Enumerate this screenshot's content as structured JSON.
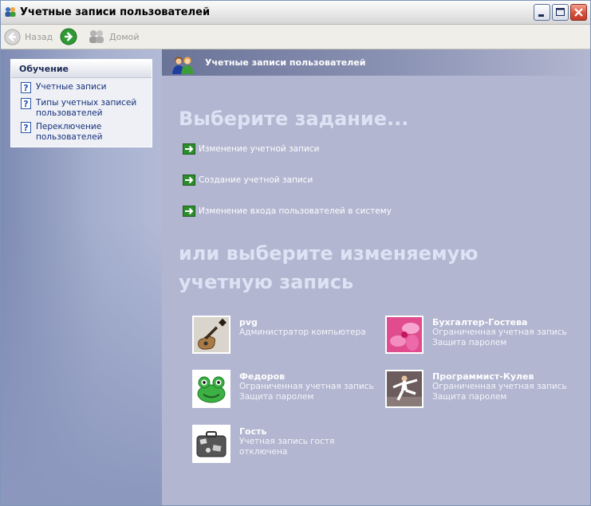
{
  "window": {
    "title": "Учетные записи пользователей"
  },
  "toolbar": {
    "back_label": "Назад",
    "home_label": "Домой"
  },
  "learn": {
    "title": "Обучение",
    "items": [
      {
        "label": "Учетные записи"
      },
      {
        "label": "Типы учетных записей пользователей"
      },
      {
        "label": "Переключение пользователей"
      }
    ]
  },
  "main": {
    "header": "Учетные записи пользователей",
    "heading_task": "Выберите задание...",
    "tasks": [
      {
        "label": "Изменение учетной записи"
      },
      {
        "label": "Создание учетной записи"
      },
      {
        "label": "Изменение входа пользователей в систему"
      }
    ],
    "heading_account": "или выберите изменяемую учетную запись"
  },
  "accounts": [
    {
      "name": "pvg",
      "lines": [
        "Администратор компьютера"
      ],
      "avatar": "guitar-picture"
    },
    {
      "name": "Бухгалтер-Гостева",
      "lines": [
        "Ограниченная учетная запись",
        "Защита паролем"
      ],
      "avatar": "flower-picture"
    },
    {
      "name": "Федоров",
      "lines": [
        "Ограниченная учетная запись",
        "Защита паролем"
      ],
      "avatar": "frog-picture"
    },
    {
      "name": "Программист-Кулев",
      "lines": [
        "Ограниченная учетная запись",
        "Защита паролем"
      ],
      "avatar": "karate-picture"
    },
    {
      "name": "Гость",
      "lines": [
        "Учетная запись гостя",
        "отключена"
      ],
      "avatar": "suitcase-picture"
    }
  ],
  "colors": {
    "accent_green": "#2c8d2c",
    "header_blue": "#6a7498",
    "pane_lavender": "#b2b6d0"
  }
}
